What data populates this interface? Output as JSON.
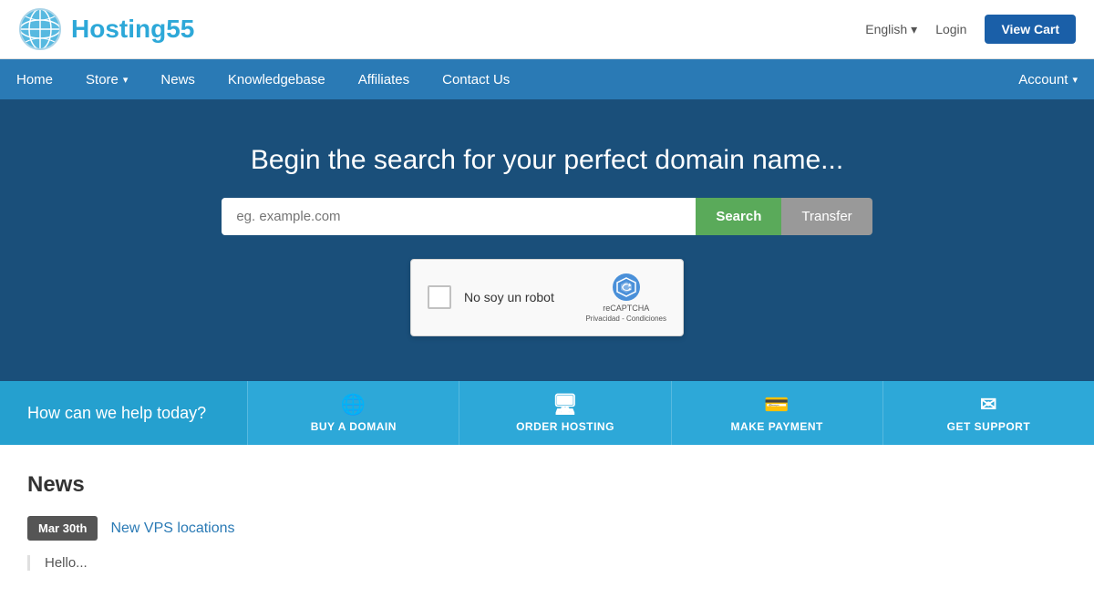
{
  "topbar": {
    "logo_text1": "Hosting",
    "logo_text2": "55",
    "language": "English",
    "login": "Login",
    "view_cart": "View Cart"
  },
  "nav": {
    "items": [
      {
        "label": "Home",
        "has_dropdown": false
      },
      {
        "label": "Store",
        "has_dropdown": true
      },
      {
        "label": "News",
        "has_dropdown": false
      },
      {
        "label": "Knowledgebase",
        "has_dropdown": false
      },
      {
        "label": "Affiliates",
        "has_dropdown": false
      },
      {
        "label": "Contact Us",
        "has_dropdown": false
      }
    ],
    "account": {
      "label": "Account",
      "has_dropdown": true
    }
  },
  "hero": {
    "heading": "Begin the search for your perfect domain name...",
    "search_placeholder": "eg. example.com",
    "search_btn": "Search",
    "transfer_btn": "Transfer"
  },
  "captcha": {
    "label": "No soy un robot",
    "brand": "reCAPTCHA",
    "privacy": "Privacidad",
    "separator": "-",
    "terms": "Condiciones"
  },
  "actionbar": {
    "help_text": "How can we help today?",
    "items": [
      {
        "label": "BUY A DOMAIN",
        "icon": "🌐"
      },
      {
        "label": "ORDER HOSTING",
        "icon": "🖥"
      },
      {
        "label": "MAKE PAYMENT",
        "icon": "💳"
      },
      {
        "label": "GET SUPPORT",
        "icon": "✉"
      }
    ]
  },
  "news": {
    "title": "News",
    "items": [
      {
        "date": "Mar 30th",
        "link_text": "New VPS locations",
        "excerpt": "Hello..."
      }
    ]
  }
}
